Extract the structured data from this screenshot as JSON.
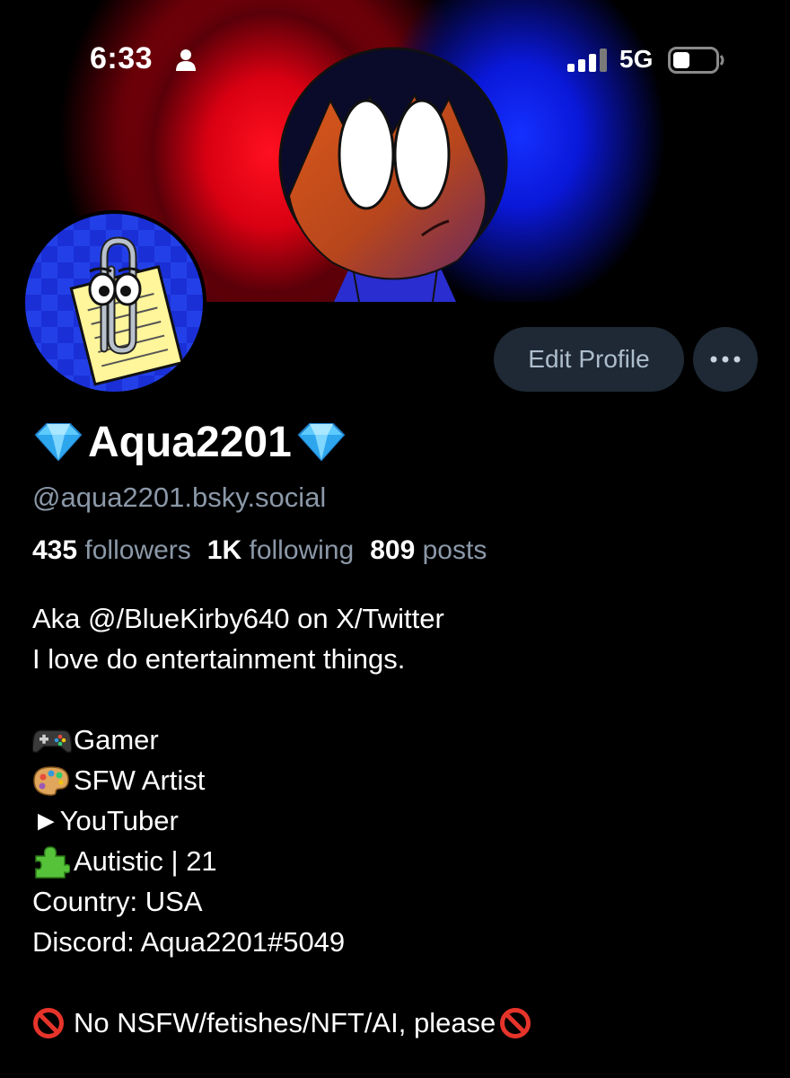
{
  "status_bar": {
    "time": "6:33",
    "network": "5G",
    "icons": [
      "person-icon",
      "cellular-signal-icon",
      "battery-icon"
    ]
  },
  "profile": {
    "display_name": "Aqua2201",
    "name_emoji": "gem-icon",
    "handle": "@aqua2201.bsky.social",
    "stats": {
      "followers_count": "435",
      "followers_label": "followers",
      "following_count": "1K",
      "following_label": "following",
      "posts_count": "809",
      "posts_label": "posts"
    },
    "actions": {
      "edit_label": "Edit Profile",
      "more_icon": "more-horizontal-icon"
    },
    "bio": {
      "line1": "Aka @/BlueKirby640 on X/Twitter",
      "line2": "I love do entertainment things.",
      "gamer": "Gamer",
      "artist": "SFW Artist",
      "youtuber": "►YouTuber",
      "autistic": "Autistic | 21",
      "country": "Country: USA",
      "discord": "Discord: Aqua2201#5049",
      "notice": "No NSFW/fetishes/NFT/AI, please"
    }
  },
  "colors": {
    "background": "#000000",
    "button_bg": "#1e2935",
    "button_text": "#aebdcc",
    "muted_text": "#8b98a8",
    "banner_red": "#ff0a14",
    "banner_blue": "#1530ff"
  }
}
